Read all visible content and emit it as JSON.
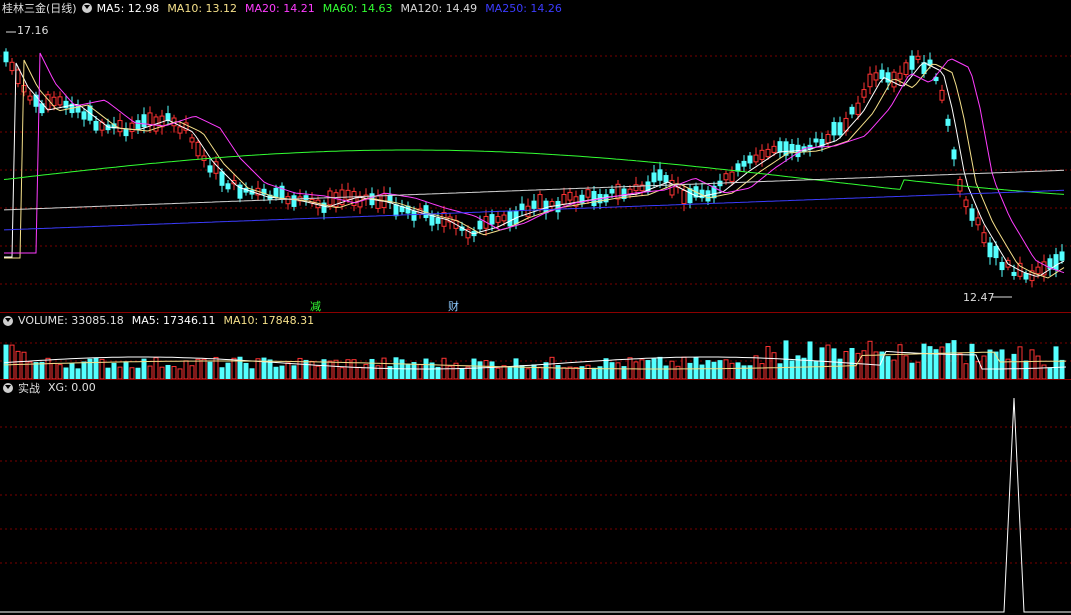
{
  "main": {
    "title": "桂林三金(日线)",
    "indicators": [
      {
        "label": "MA5: 12.98",
        "color": "#ffffff"
      },
      {
        "label": "MA10: 13.12",
        "color": "#f5e08a"
      },
      {
        "label": "MA20: 14.21",
        "color": "#ff3cff"
      },
      {
        "label": "MA60: 14.63",
        "color": "#33ff33"
      },
      {
        "label": "MA120: 14.49",
        "color": "#d8d8d8"
      },
      {
        "label": "MA250: 14.26",
        "color": "#3c3cff"
      }
    ],
    "high_label": "17.16",
    "low_label": "12.47",
    "markers": [
      {
        "label": "减",
        "color": "#33ff33"
      },
      {
        "label": "财",
        "color": "#8ecbff"
      }
    ]
  },
  "volume": {
    "title": "VOLUME: 33085.18",
    "ma5": "MA5: 17346.11",
    "ma10": "MA10: 17848.31",
    "ma5_color": "#ffffff",
    "ma10_color": "#f5e08a"
  },
  "indicator": {
    "title": "实战",
    "xg": "XG: 0.00"
  },
  "colors": {
    "up": "#ff3333",
    "down": "#54ffff",
    "grid": "#7a0000",
    "background": "#000000"
  }
}
